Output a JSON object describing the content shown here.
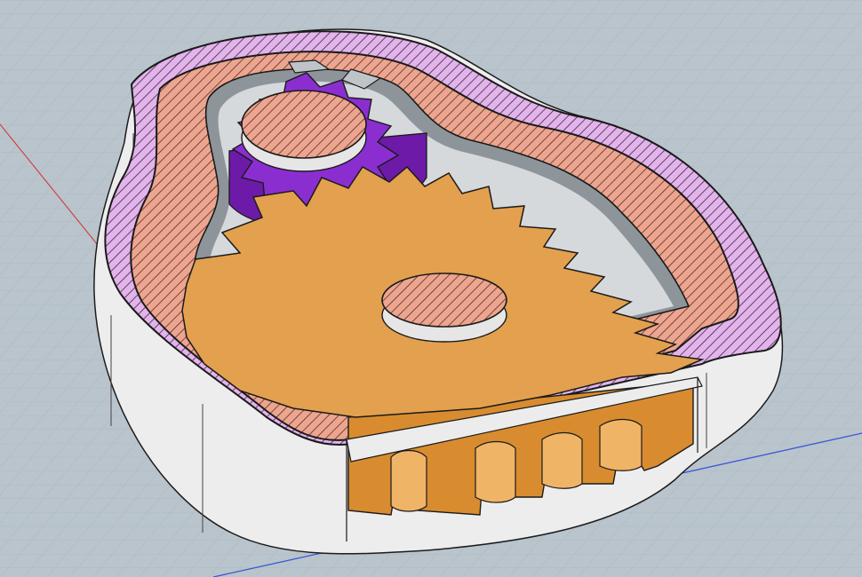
{
  "viewport": {
    "kind": "3d-section-view",
    "background_color": "#b9c4cc",
    "grid_color": "#a7b4be",
    "axis_x_color": "#3a57d6",
    "axis_y_color": "#d23a3a"
  },
  "model": {
    "parts": [
      {
        "name": "housing",
        "color": "#ececec",
        "hatch_color": "#c58ad6"
      },
      {
        "name": "housing-seal-layer",
        "hatch_color": "#e9a18c"
      },
      {
        "name": "large-gear",
        "color": "#e3a04e",
        "teeth": 16
      },
      {
        "name": "small-gear",
        "color": "#8b2ed0",
        "teeth": 9
      },
      {
        "name": "large-gear-shaft",
        "hatch_color": "#e9a18c"
      },
      {
        "name": "small-gear-shaft",
        "hatch_color": "#e9a18c"
      }
    ]
  }
}
